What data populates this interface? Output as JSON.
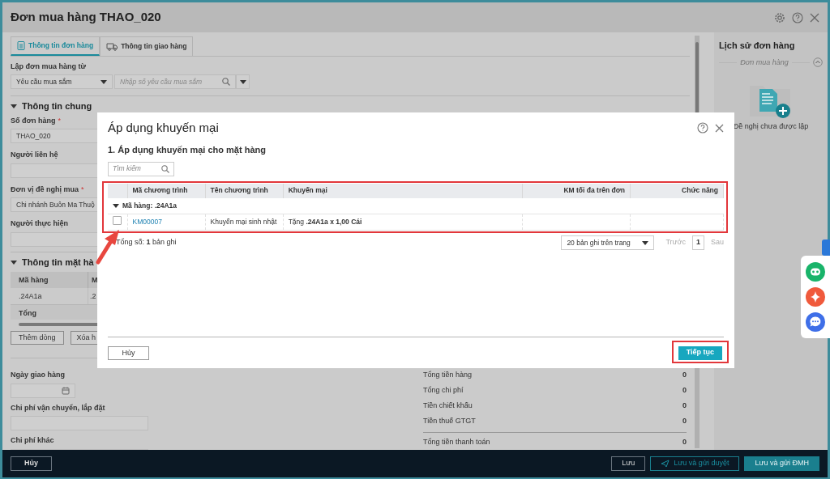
{
  "window": {
    "title": "Đơn mua hàng THAO_020"
  },
  "tabs": [
    {
      "label": "Thông tin đơn hàng",
      "selected": true
    },
    {
      "label": "Thông tin giao hàng",
      "selected": false
    }
  ],
  "source": {
    "label": "Lập đơn mua hàng từ",
    "type_value": "Yêu cầu mua sắm",
    "search_placeholder": "Nhập số yêu cầu mua sắm"
  },
  "general": {
    "title": "Thông tin chung",
    "expanded": true,
    "fields": [
      {
        "label": "Số đơn hàng",
        "mark": "*",
        "value": "THAO_020"
      },
      {
        "label": "Người liên hệ"
      },
      {
        "label": "Đơn vị đề nghị mua",
        "mark": "*",
        "value": "Chi nhánh Buôn Ma Thuộ"
      },
      {
        "label": "Người thực hiện"
      }
    ]
  },
  "items": {
    "title": "Thông tin mặt hà",
    "expanded": true,
    "columns": [
      "Mã hàng",
      "M"
    ],
    "rows": [
      [
        ".24A1a",
        ".2"
      ]
    ],
    "total_label": "Tổng",
    "buttons": [
      "Thêm dòng",
      "Xóa h"
    ]
  },
  "delivery": [
    {
      "label": "Ngày giao hàng",
      "kind": "date"
    },
    {
      "label": "Chi phí vận chuyển, lắp đặt",
      "kind": "text"
    },
    {
      "label": "Chi phí khác",
      "kind": "text"
    }
  ],
  "summary": [
    {
      "label": "Tổng tiền hàng",
      "value": "0",
      "kind": "line"
    },
    {
      "label": "Tổng chi phí",
      "value": "0",
      "kind": "line"
    },
    {
      "label": "Tiền chiết khấu",
      "value": "0",
      "kind": "line"
    },
    {
      "label": "Tiền thuế GTGT",
      "value": "0",
      "kind": "line"
    },
    {
      "label": "Tổng tiền thanh toán",
      "value": "0",
      "kind": "total"
    }
  ],
  "history": {
    "title": "Lịch sử đơn hàng",
    "section": "Đơn mua hàng",
    "empty_text": "Đề nghị chưa được lập"
  },
  "footer": {
    "cancel": "Hủy",
    "buttons": [
      {
        "label": "Lưu",
        "kind": "outline"
      },
      {
        "label": "Lưu và gửi duyệt",
        "kind": "send"
      },
      {
        "label": "Lưu và gửi ĐMH",
        "kind": "primary"
      }
    ]
  },
  "dialog": {
    "title": "Áp dụng khuyến mại",
    "subtitle": "1. Áp dụng khuyến mại cho mặt hàng",
    "search_placeholder": "Tìm kiếm",
    "columns": [
      "Mã chương trình",
      "Tên chương trình",
      "Khuyến mại",
      "KM tối đa trên đơn",
      "Chức năng"
    ],
    "groups": [
      {
        "label": "Mã hàng: .24A1a",
        "expanded": true,
        "rows": [
          {
            "checked": false,
            "code": "KM00007",
            "name": "Khuyến mại sinh nhật",
            "promotion": "Tặng **.24A1a x 1,00 Cái**"
          }
        ]
      }
    ],
    "total": "Tổng số: **1** bản ghi",
    "page_size": "20 bản ghi trên trang",
    "prev": "Trước",
    "page": "1",
    "next": "Sau",
    "cancel": "Hủy",
    "continue": "Tiếp tục"
  }
}
